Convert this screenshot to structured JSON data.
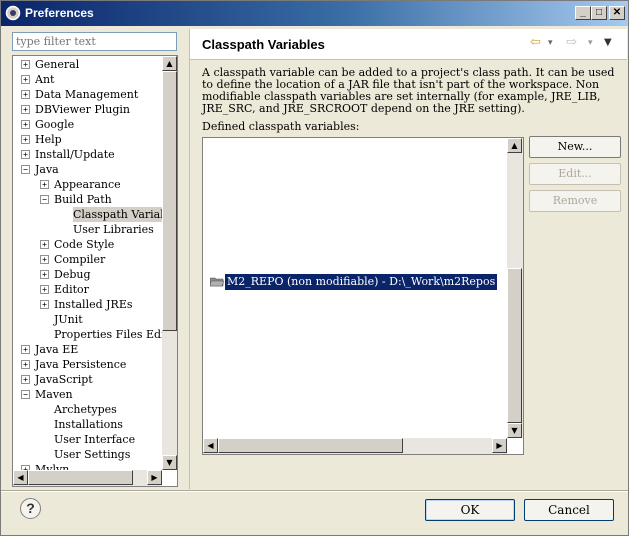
{
  "window": {
    "title": "Preferences",
    "buttons": {
      "minimize": "_",
      "maximize": "□",
      "close": "✕"
    }
  },
  "filter": {
    "placeholder": "type filter text"
  },
  "tree": {
    "items": [
      {
        "label": "General",
        "expander": "+"
      },
      {
        "label": "Ant",
        "expander": "+"
      },
      {
        "label": "Data Management",
        "expander": "+"
      },
      {
        "label": "DBViewer Plugin",
        "expander": "+"
      },
      {
        "label": "Google",
        "expander": "+"
      },
      {
        "label": "Help",
        "expander": "+"
      },
      {
        "label": "Install/Update",
        "expander": "+"
      },
      {
        "label": "Java",
        "expander": "−"
      },
      {
        "label": "Appearance",
        "expander": "+"
      },
      {
        "label": "Build Path",
        "expander": "−"
      },
      {
        "label": "Classpath Variables",
        "expander": ""
      },
      {
        "label": "User Libraries",
        "expander": ""
      },
      {
        "label": "Code Style",
        "expander": "+"
      },
      {
        "label": "Compiler",
        "expander": "+"
      },
      {
        "label": "Debug",
        "expander": "+"
      },
      {
        "label": "Editor",
        "expander": "+"
      },
      {
        "label": "Installed JREs",
        "expander": "+"
      },
      {
        "label": "JUnit",
        "expander": ""
      },
      {
        "label": "Properties Files Editor",
        "expander": ""
      },
      {
        "label": "Java EE",
        "expander": "+"
      },
      {
        "label": "Java Persistence",
        "expander": "+"
      },
      {
        "label": "JavaScript",
        "expander": "+"
      },
      {
        "label": "Maven",
        "expander": "−"
      },
      {
        "label": "Archetypes",
        "expander": ""
      },
      {
        "label": "Installations",
        "expander": ""
      },
      {
        "label": "User Interface",
        "expander": ""
      },
      {
        "label": "User Settings",
        "expander": ""
      },
      {
        "label": "Mylyn",
        "expander": "+"
      }
    ],
    "selected": "Classpath Variables"
  },
  "page": {
    "title": "Classpath Variables",
    "nav": {
      "back": "⇦",
      "back_menu": "▾",
      "forward": "⇨",
      "forward_menu": "▾",
      "view_menu": "▼"
    },
    "description": "A classpath variable can be added to a project's class path. It can be used to define the location of a JAR file that isn't part of the workspace. Non modifiable classpath variables are set internally (for example, JRE_LIB, JRE_SRC, and JRE_SRCROOT depend on the JRE setting).",
    "defined_label": "Defined classpath variables:",
    "variables": [
      {
        "text": "M2_REPO (non modifiable) - D:\\_Work\\m2Repos"
      }
    ],
    "buttons": {
      "new": "New...",
      "edit": "Edit...",
      "remove": "Remove"
    }
  },
  "footer": {
    "help": "?",
    "ok": "OK",
    "cancel": "Cancel"
  },
  "colors": {
    "selection": "#0a246a",
    "titlebar": "#0a246a",
    "dialog_bg": "#ece9d8"
  }
}
